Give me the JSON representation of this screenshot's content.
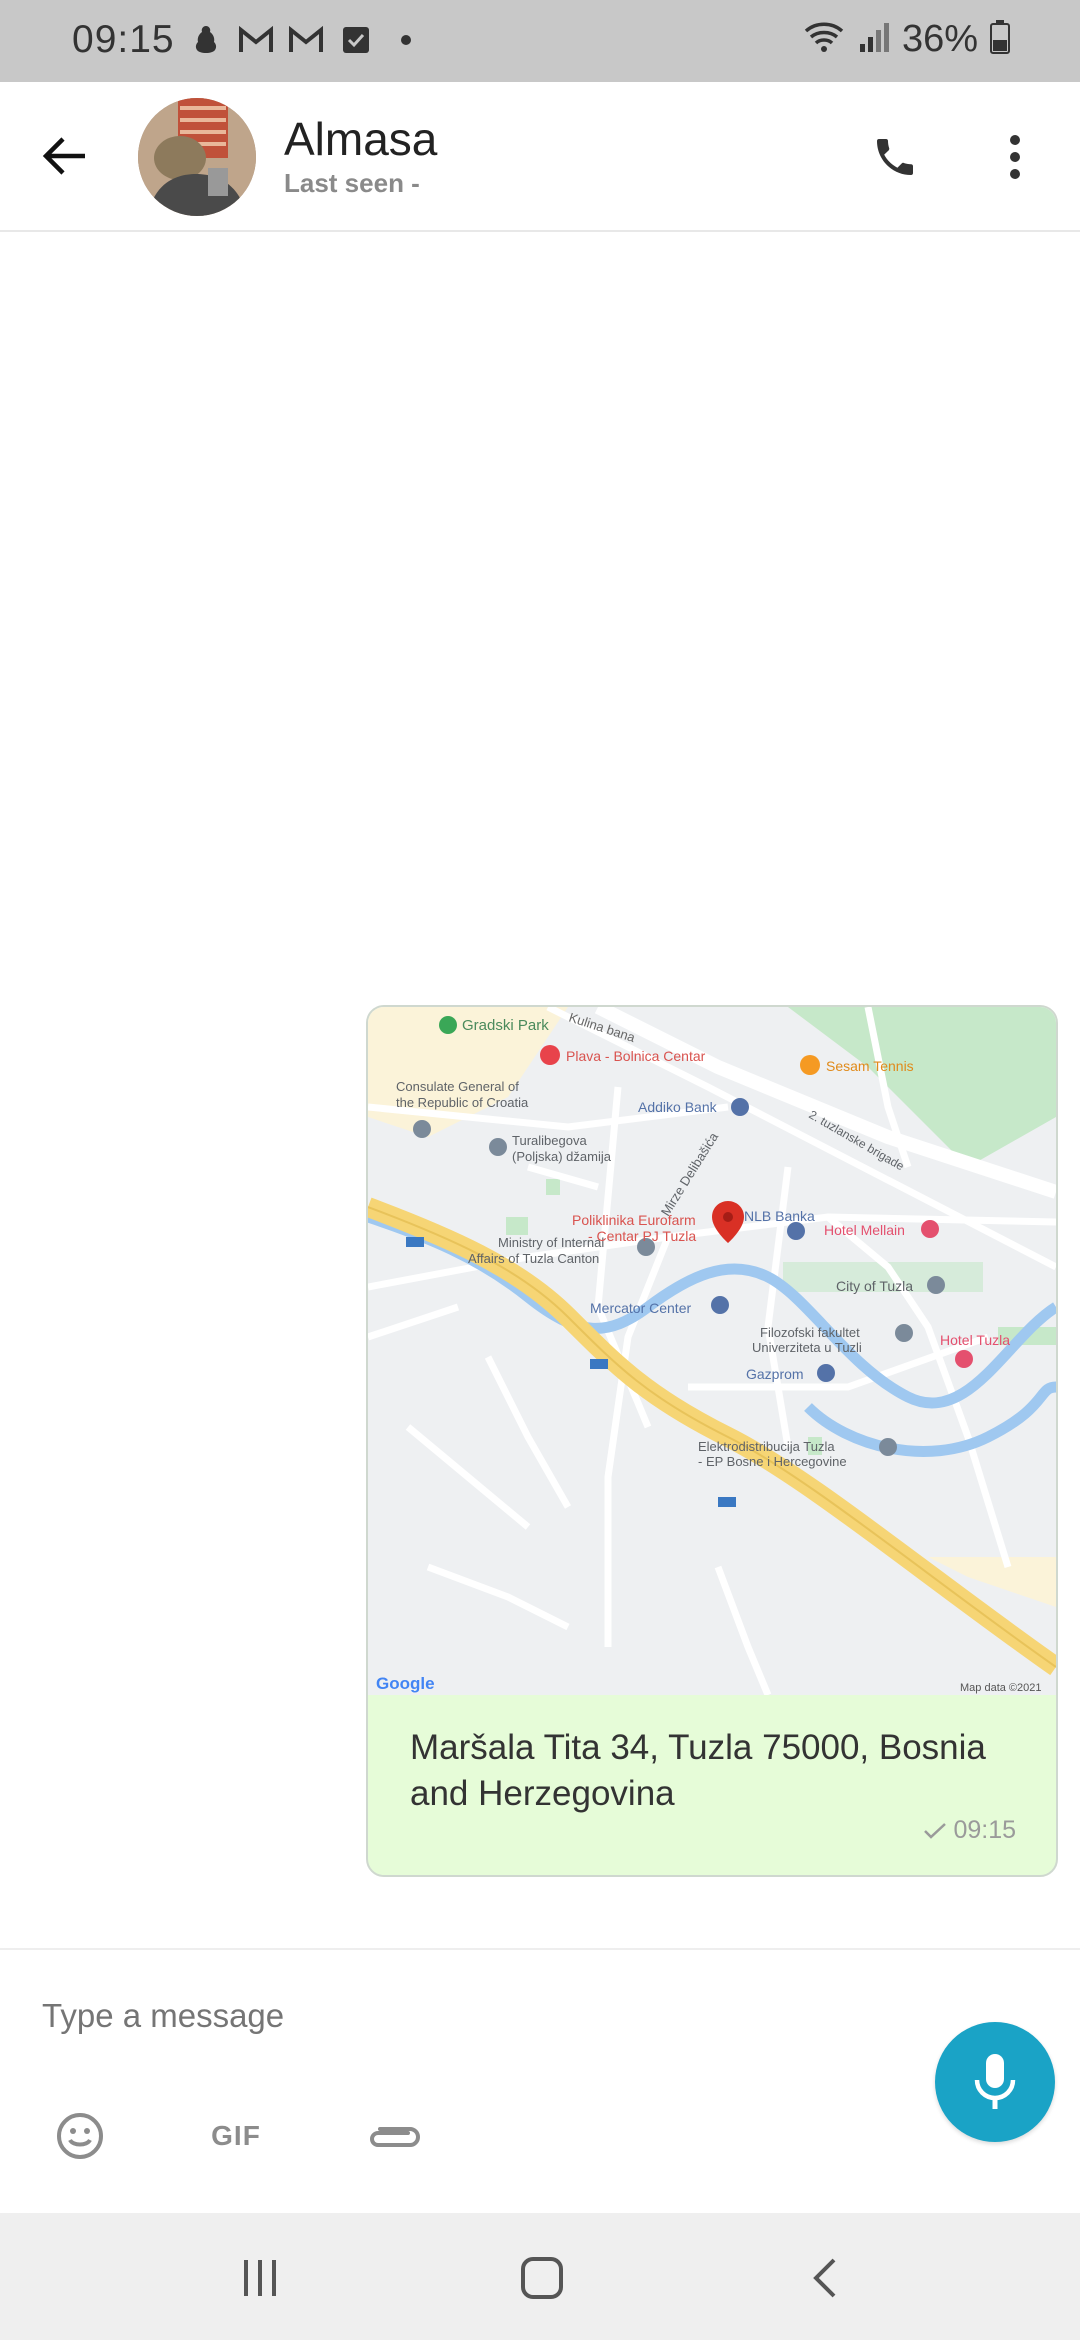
{
  "status_bar": {
    "time": "09:15",
    "battery_text": "36%",
    "icons_left": [
      "notification-icon",
      "gmail-icon",
      "gmail-icon",
      "checkbox-icon",
      "dot-icon"
    ],
    "icons_right": [
      "wifi-icon",
      "signal-icon",
      "battery-icon"
    ]
  },
  "header": {
    "contact_name": "Almasa",
    "last_seen": "Last seen -"
  },
  "message": {
    "address": "Maršala Tita 34, Tuzla 75000, Bosnia and Herzegovina",
    "time": "09:15",
    "status": "sent"
  },
  "map": {
    "labels": {
      "gradski_park": "Gradski Park",
      "kulina_bana": "Kulina bana",
      "plava": "Plava - Bolnica Centar",
      "sesam": "Sesam Tennis",
      "consulate": "Consulate General of the Republic of Croatia",
      "addiko": "Addiko Bank",
      "turalibegova": "Turalibegova (Poljska) džamija",
      "mirze": "Mirze Delibašića",
      "brigade": "2. tuzlanske brigade",
      "ministry": "Ministry of Internal Affairs of Tuzla Canton",
      "poliklinika": "Poliklinika Eurofarm - Centar PJ Tuzla",
      "nlb": "NLB Banka",
      "mellain": "Hotel Mellain",
      "city": "City of Tuzla",
      "mercator": "Mercator Center",
      "filozofski": "Filozofski fakultet Univerziteta u Tuzli",
      "hotel_tuzla": "Hotel Tuzla",
      "gazprom": "Gazprom",
      "elektro": "Elektrodistribucija Tuzla - EP Bosne i Hercegovine",
      "google": "Google",
      "map_data": "Map data ©2021"
    }
  },
  "composer": {
    "placeholder": "Type a message",
    "gif_label": "GIF"
  },
  "colors": {
    "accent": "#1aa3c6",
    "bubble": "#e6fcd8",
    "status_bar": "#c8c8c8",
    "road_major": "#f6d575",
    "river": "#9fc8f0",
    "park": "#c6e8c9",
    "poi_red": "#e8434b"
  }
}
